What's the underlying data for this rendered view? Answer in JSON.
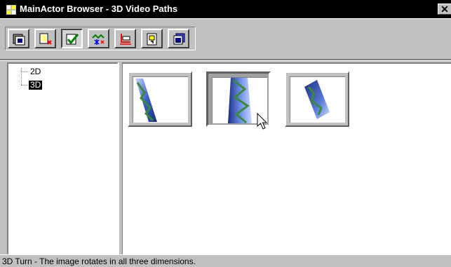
{
  "window": {
    "title": "MainActor Browser - 3D Video Paths",
    "close_glyph": "✕"
  },
  "toolbar": {
    "buttons": [
      {
        "name": "tool-video-icon",
        "pressed": false
      },
      {
        "name": "tool-effect-icon",
        "pressed": false
      },
      {
        "name": "tool-check-icon",
        "pressed": true
      },
      {
        "name": "tool-sparkle-icon",
        "pressed": false
      },
      {
        "name": "tool-path-icon",
        "pressed": false
      },
      {
        "name": "tool-transition-icon",
        "pressed": false
      },
      {
        "name": "tool-layers-icon",
        "pressed": false
      }
    ]
  },
  "tree": {
    "items": [
      {
        "label": "2D",
        "selected": false
      },
      {
        "label": "3D",
        "selected": true
      }
    ]
  },
  "thumbnails": [
    {
      "name": "path-thumbnail-1",
      "selected": false
    },
    {
      "name": "path-thumbnail-2",
      "selected": true
    },
    {
      "name": "path-thumbnail-3",
      "selected": false
    }
  ],
  "status": {
    "text": "3D Turn - The image rotates in all three dimensions."
  },
  "colors": {
    "titlebar": "#000000",
    "face": "#c0c0c0",
    "accent_blue": "#2f4fb0",
    "accent_green": "#3a8a3a"
  }
}
